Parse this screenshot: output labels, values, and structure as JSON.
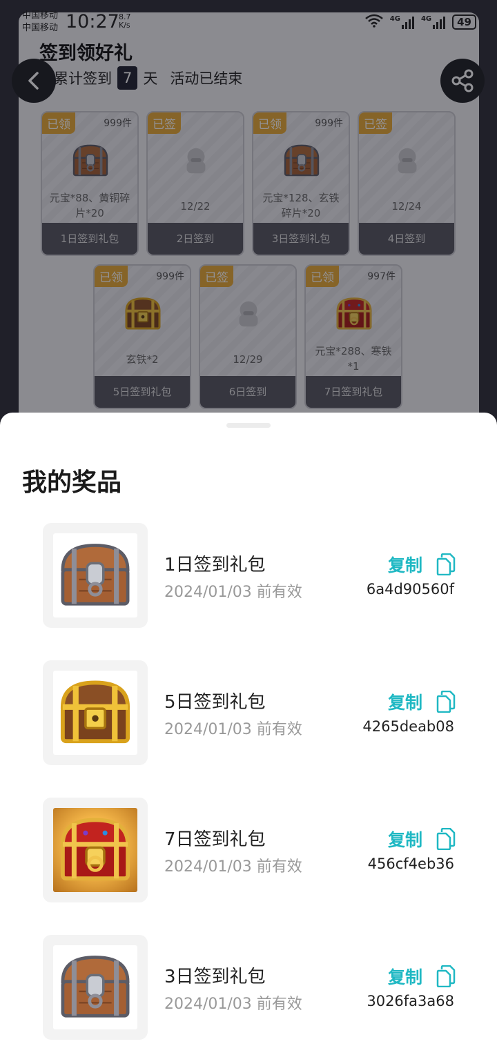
{
  "status_bar": {
    "carrier_1": "中国移动",
    "carrier_2": "中国移动",
    "time": "10:27",
    "speed_value": "8.7",
    "speed_unit": "K/s",
    "net_1": "4G",
    "net_2": "4G",
    "battery": "49"
  },
  "background": {
    "title": "签到领好礼",
    "progress_prefix": "已累计签到",
    "progress_days": "7",
    "progress_suffix": "天",
    "activity_status": "活动已结束",
    "cards": [
      {
        "tag": "已领",
        "count": "999件",
        "text": "元宝*88、黄铜碎片*20",
        "bar": "1日签到礼包",
        "icon": "chest-bronze"
      },
      {
        "tag": "已签",
        "count": "",
        "text": "12/22",
        "bar": "2日签到",
        "icon": "mascot-placeholder"
      },
      {
        "tag": "已领",
        "count": "999件",
        "text": "元宝*128、玄铁碎片*20",
        "bar": "3日签到礼包",
        "icon": "chest-bronze"
      },
      {
        "tag": "已签",
        "count": "",
        "text": "12/24",
        "bar": "4日签到",
        "icon": "mascot-placeholder"
      },
      {
        "tag": "已领",
        "count": "999件",
        "text": "玄铁*2",
        "bar": "5日签到礼包",
        "icon": "chest-gold"
      },
      {
        "tag": "已签",
        "count": "",
        "text": "12/29",
        "bar": "6日签到",
        "icon": "mascot-placeholder"
      },
      {
        "tag": "已领",
        "count": "997件",
        "text": "元宝*288、寒铁*1",
        "bar": "7日签到礼包",
        "icon": "chest-red"
      }
    ]
  },
  "sheet": {
    "title": "我的奖品",
    "copy_label": "复制",
    "prizes": [
      {
        "name": "1日签到礼包",
        "valid": "2024/01/03 前有效",
        "code": "6a4d90560f",
        "icon": "chest-bronze"
      },
      {
        "name": "5日签到礼包",
        "valid": "2024/01/03 前有效",
        "code": "4265deab08",
        "icon": "chest-gold"
      },
      {
        "name": "7日签到礼包",
        "valid": "2024/01/03 前有效",
        "code": "456cf4eb36",
        "icon": "chest-red"
      },
      {
        "name": "3日签到礼包",
        "valid": "2024/01/03 前有效",
        "code": "3026fa3a68",
        "icon": "chest-bronze"
      }
    ]
  },
  "colors": {
    "accent": "#1fb8c3",
    "tag": "#e7a935",
    "dark_button": "#1e1f24"
  }
}
